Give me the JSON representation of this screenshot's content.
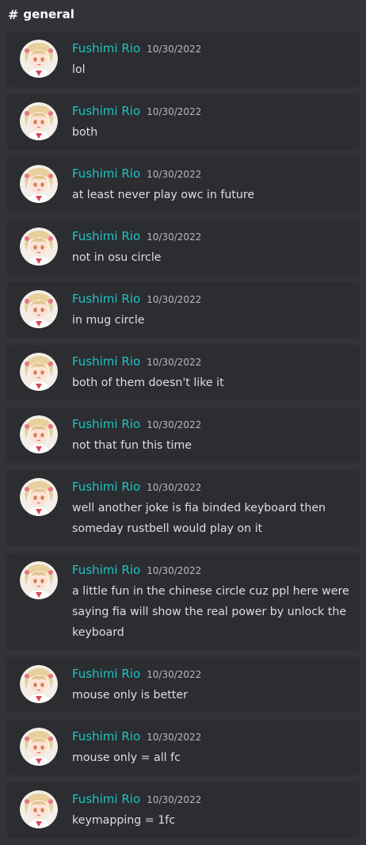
{
  "channel": {
    "icon": "hash-icon",
    "hash": "#",
    "name": "general"
  },
  "colors": {
    "background": "#313338",
    "card": "#2b2d31",
    "username": "#1fc4c4",
    "timestamp": "#b6b8bf",
    "text": "#dcdee3"
  },
  "messages": [
    {
      "author": "Fushimi Rio",
      "timestamp": "10/30/2022",
      "text": "lol"
    },
    {
      "author": "Fushimi Rio",
      "timestamp": "10/30/2022",
      "text": "both"
    },
    {
      "author": "Fushimi Rio",
      "timestamp": "10/30/2022",
      "text": "at least never play owc in future"
    },
    {
      "author": "Fushimi Rio",
      "timestamp": "10/30/2022",
      "text": "not in osu circle"
    },
    {
      "author": "Fushimi Rio",
      "timestamp": "10/30/2022",
      "text": "in mug circle"
    },
    {
      "author": "Fushimi Rio",
      "timestamp": "10/30/2022",
      "text": "both of them doesn't like it"
    },
    {
      "author": "Fushimi Rio",
      "timestamp": "10/30/2022",
      "text": "not that fun this time"
    },
    {
      "author": "Fushimi Rio",
      "timestamp": "10/30/2022",
      "text": "well another joke is fia binded keyboard then someday rustbell would play on it"
    },
    {
      "author": "Fushimi Rio",
      "timestamp": "10/30/2022",
      "text": "a little fun in the chinese circle cuz ppl here were saying fia will show the real power by unlock the keyboard"
    },
    {
      "author": "Fushimi Rio",
      "timestamp": "10/30/2022",
      "text": "mouse only is better"
    },
    {
      "author": "Fushimi Rio",
      "timestamp": "10/30/2022",
      "text": "mouse only = all fc"
    },
    {
      "author": "Fushimi Rio",
      "timestamp": "10/30/2022",
      "text": "keymapping = 1fc"
    }
  ]
}
